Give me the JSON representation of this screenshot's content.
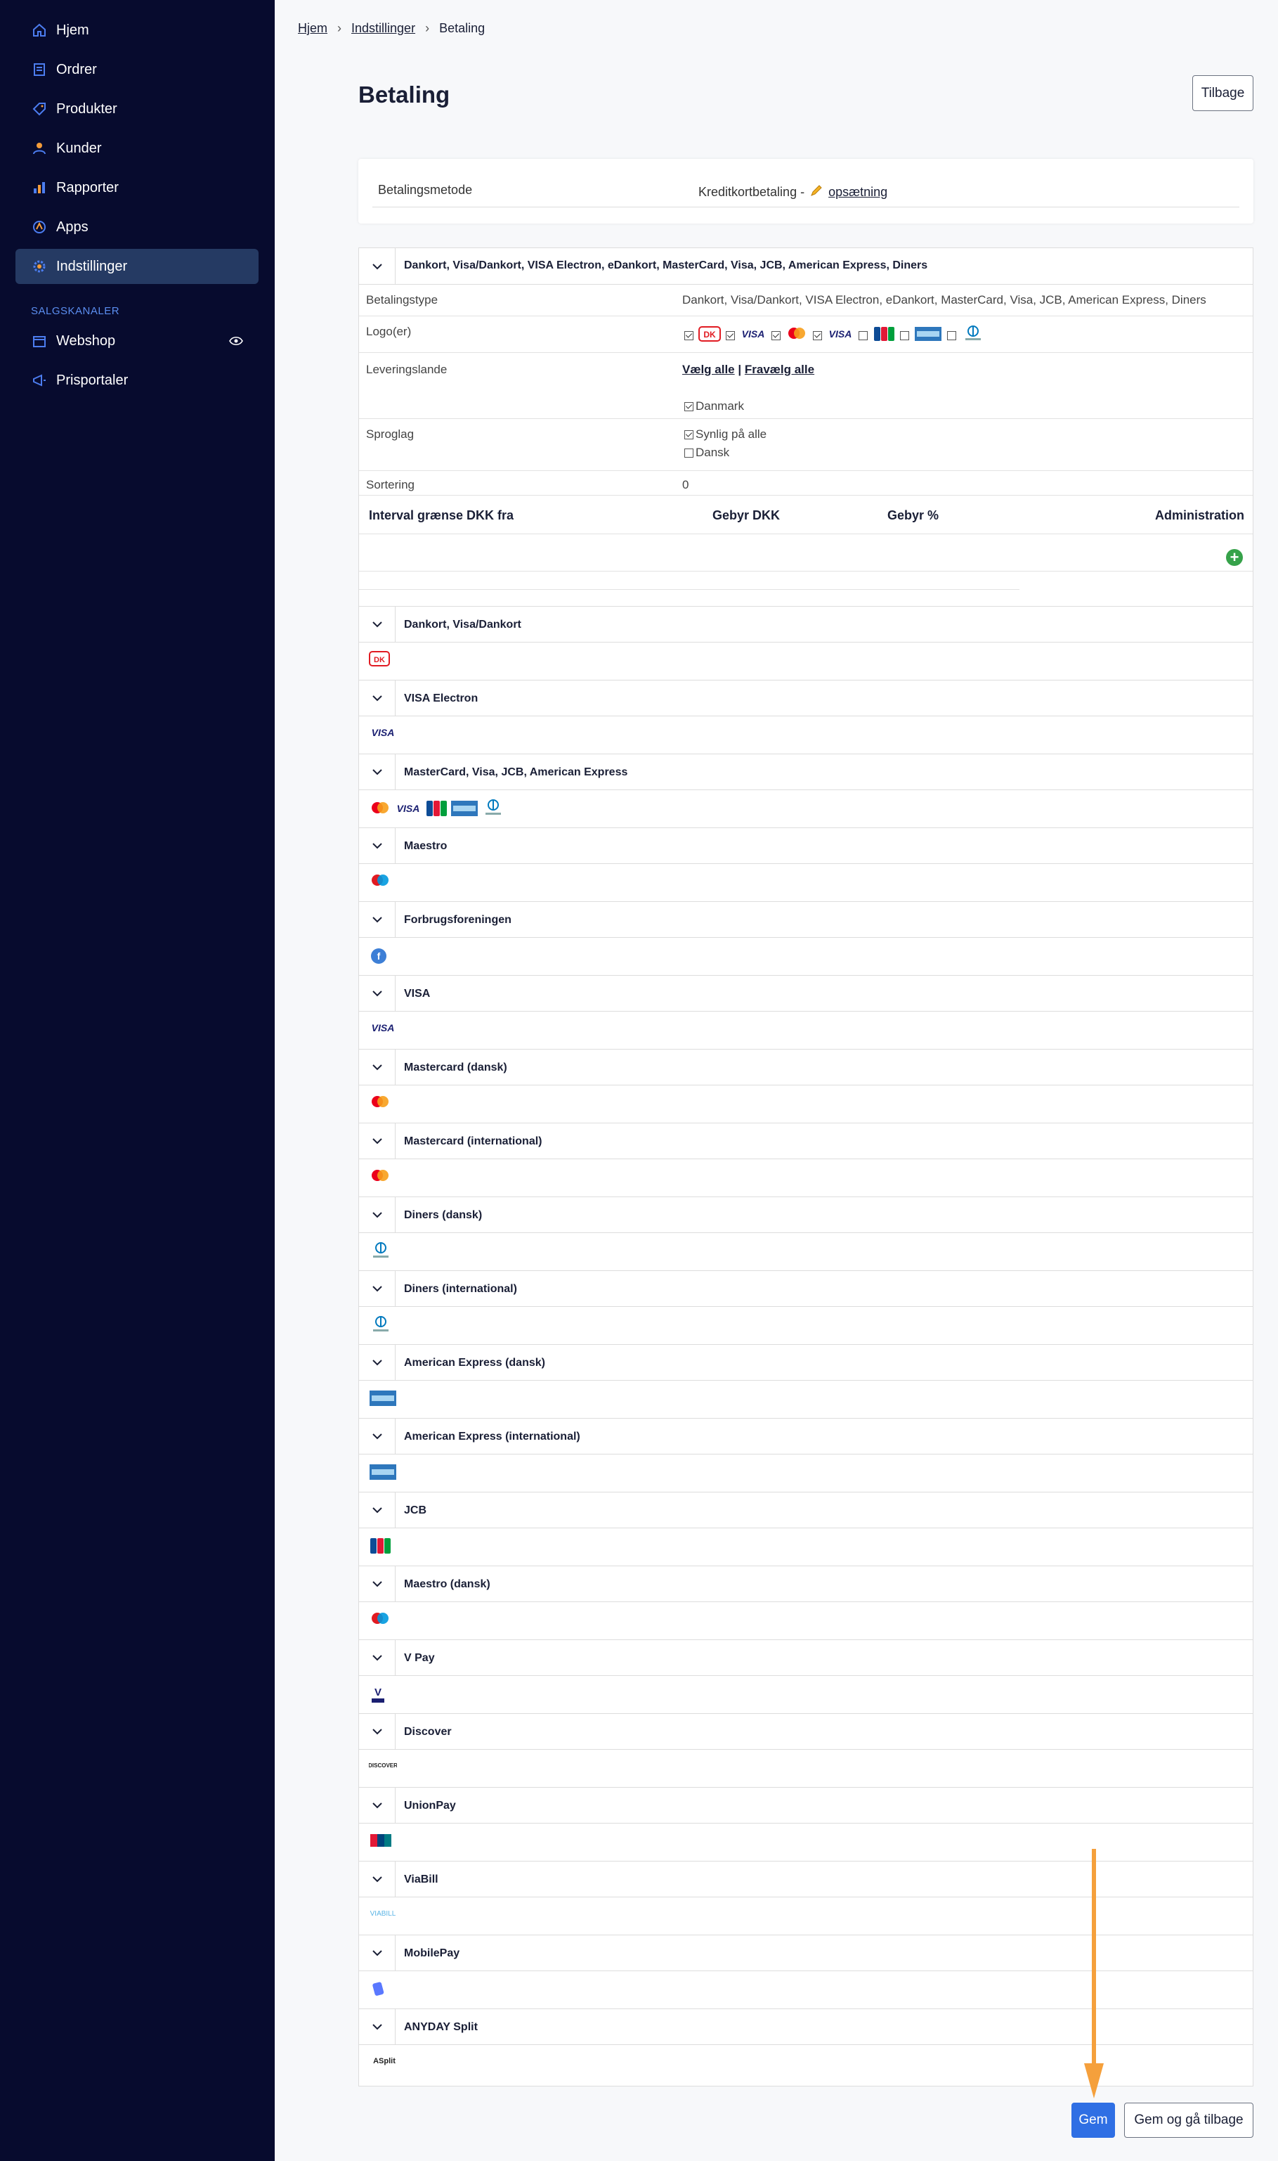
{
  "sidebar": {
    "items": [
      {
        "label": "Hjem",
        "icon": "home-icon"
      },
      {
        "label": "Ordrer",
        "icon": "orders-icon"
      },
      {
        "label": "Produkter",
        "icon": "tag-icon"
      },
      {
        "label": "Kunder",
        "icon": "user-icon"
      },
      {
        "label": "Rapporter",
        "icon": "chart-icon"
      },
      {
        "label": "Apps",
        "icon": "apps-icon"
      },
      {
        "label": "Indstillinger",
        "icon": "gear-icon",
        "active": true
      }
    ],
    "section_label": "SALGSKANALER",
    "channels": [
      {
        "label": "Webshop",
        "icon": "store-icon"
      },
      {
        "label": "Prisportaler",
        "icon": "megaphone-icon"
      }
    ]
  },
  "breadcrumb": {
    "home": "Hjem",
    "settings": "Indstillinger",
    "current": "Betaling"
  },
  "page": {
    "title": "Betaling",
    "back_button": "Tilbage"
  },
  "method": {
    "label": "Betalingsmetode",
    "value": "Kreditkortbetaling -",
    "link": "opsætning"
  },
  "panel": {
    "title": "Dankort, Visa/Dankort, VISA Electron, eDankort, MasterCard, Visa, JCB, American Express, Diners",
    "rows": {
      "type_label": "Betalingstype",
      "type_value": "Dankort, Visa/Dankort, VISA Electron, eDankort, MasterCard, Visa, JCB, American Express, Diners",
      "logo_label": "Logo(er)",
      "countries_label": "Leveringslande",
      "select_all": "Vælg alle",
      "divider": "|",
      "deselect_all": "Fravælg alle",
      "country": "Danmark",
      "language_label": "Sproglag",
      "lang_all": "Synlig på alle",
      "lang_dk": "Dansk",
      "sort_label": "Sortering",
      "sort_value": "0"
    },
    "interval": {
      "col1": "Interval grænse DKK fra",
      "col2": "Gebyr DKK",
      "col3": "Gebyr %",
      "col4": "Administration",
      "add_symbol": "+"
    }
  },
  "subsections": [
    {
      "title": "Dankort, Visa/Dankort",
      "logos": [
        "dankort"
      ]
    },
    {
      "title": "VISA Electron",
      "logos": [
        "visa"
      ]
    },
    {
      "title": "MasterCard, Visa, JCB, American Express",
      "logos": [
        "mastercard",
        "visa",
        "jcb",
        "amex",
        "diners"
      ]
    },
    {
      "title": "Maestro",
      "logos": [
        "maestro"
      ]
    },
    {
      "title": "Forbrugsforeningen",
      "logos": [
        "forbrugs"
      ]
    },
    {
      "title": "VISA",
      "logos": [
        "visa"
      ]
    },
    {
      "title": "Mastercard (dansk)",
      "logos": [
        "mastercard"
      ]
    },
    {
      "title": "Mastercard (international)",
      "logos": [
        "mastercard"
      ]
    },
    {
      "title": "Diners (dansk)",
      "logos": [
        "diners"
      ]
    },
    {
      "title": "Diners (international)",
      "logos": [
        "diners"
      ]
    },
    {
      "title": "American Express (dansk)",
      "logos": [
        "amex"
      ]
    },
    {
      "title": "American Express (international)",
      "logos": [
        "amex"
      ]
    },
    {
      "title": "JCB",
      "logos": [
        "jcb"
      ]
    },
    {
      "title": "Maestro (dansk)",
      "logos": [
        "maestro"
      ]
    },
    {
      "title": "V Pay",
      "logos": [
        "vpay"
      ]
    },
    {
      "title": "Discover",
      "logos": [
        "discover"
      ]
    },
    {
      "title": "UnionPay",
      "logos": [
        "unionpay"
      ]
    },
    {
      "title": "ViaBill",
      "logos": [
        "viabill"
      ]
    },
    {
      "title": "MobilePay",
      "logos": [
        "mobilepay"
      ]
    },
    {
      "title": "ANYDAY Split",
      "logos": [
        "anyday"
      ]
    }
  ],
  "logo_text": {
    "visa": "VISA",
    "vpay": "V",
    "discover": "DISCOVER",
    "viabill": "VIABILL",
    "anyday": "ASplit",
    "dankort": "DK"
  },
  "footer": {
    "save": "Gem",
    "save_back": "Gem og gå tilbage"
  },
  "colors": {
    "sidebar_bg": "#070b2e",
    "active_bg": "#253a63",
    "primary": "#2f6fe4",
    "annotation_arrow": "#f5a03c"
  }
}
